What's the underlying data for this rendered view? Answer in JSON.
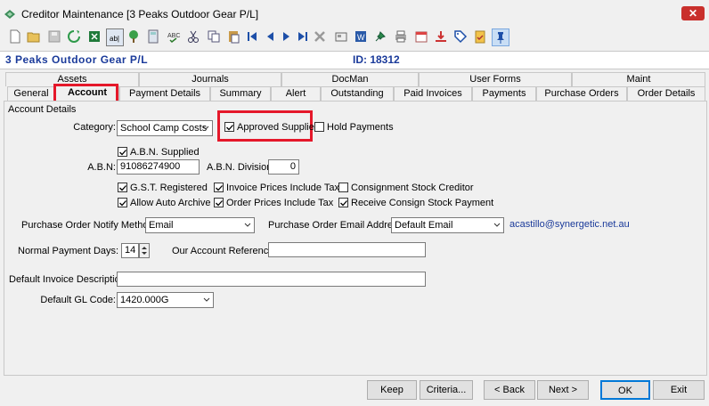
{
  "window": {
    "title": "Creditor Maintenance  [3 Peaks Outdoor Gear P/L]",
    "close_label": "✕"
  },
  "toolbar": {
    "icons": [
      "new-icon",
      "open-icon",
      "save-icon",
      "refresh-icon",
      "excel-icon",
      "text-field-icon",
      "tree-icon",
      "calculator-icon",
      "spell-check-icon",
      "cut-icon",
      "copy-icon",
      "paste-icon",
      "first-icon",
      "prev-icon",
      "next-icon",
      "last-icon",
      "delete-icon",
      "card-icon",
      "word-icon",
      "pin-icon",
      "print-icon",
      "calendar-icon",
      "download-icon",
      "tag-icon",
      "clipboard-icon",
      "pin-active-icon"
    ]
  },
  "info": {
    "creditor_name": "3 Peaks Outdoor Gear P/L",
    "id_text": "ID: 18312"
  },
  "tabs": {
    "row1": [
      "Assets",
      "Journals",
      "DocMan",
      "User Forms",
      "Maint"
    ],
    "row2": [
      "General",
      "Account",
      "Payment Details",
      "Summary",
      "Alert",
      "Outstanding",
      "Paid Invoices",
      "Payments",
      "Purchase Orders",
      "Order Details"
    ],
    "active": "Account"
  },
  "form": {
    "group_title": "Account Details",
    "category_label": "Category:",
    "category_value": "School Camp Costs",
    "approved_supplier_label": "Approved Supplier",
    "approved_supplier_checked": true,
    "hold_payments_label": "Hold Payments",
    "hold_payments_checked": false,
    "abn_supplied_label": "A.B.N. Supplied",
    "abn_supplied_checked": true,
    "abn_label": "A.B.N:",
    "abn_value": "91086274900",
    "abn_division_label": "A.B.N. Division:",
    "abn_division_value": "0",
    "gst_registered_label": "G.S.T. Registered",
    "gst_registered_checked": true,
    "invoice_prices_label": "Invoice Prices Include Tax",
    "invoice_prices_checked": true,
    "consignment_label": "Consignment Stock Creditor",
    "consignment_checked": false,
    "auto_archive_label": "Allow Auto Archive",
    "auto_archive_checked": true,
    "order_prices_label": "Order Prices Include Tax",
    "order_prices_checked": true,
    "receive_consign_label": "Receive Consign Stock Payment",
    "receive_consign_checked": true,
    "po_notify_label": "Purchase Order Notify Method:",
    "po_notify_value": "Email",
    "po_email_label": "Purchase Order Email Address:",
    "po_email_value": "Default Email",
    "po_email_link": "acastillo@synergetic.net.au",
    "payment_days_label": "Normal Payment Days:",
    "payment_days_value": "14",
    "account_ref_label": "Our Account Reference:",
    "account_ref_value": "",
    "invoice_desc_label": "Default Invoice Description:",
    "invoice_desc_value": "",
    "gl_code_label": "Default GL Code:",
    "gl_code_value": "1420.000G"
  },
  "buttons": {
    "keep": "Keep",
    "criteria": "Criteria...",
    "back": "< Back",
    "next": "Next >",
    "ok": "OK",
    "exit": "Exit"
  },
  "colors": {
    "highlight": "#e5182a",
    "info_text": "#1a3a9a",
    "ok_border": "#0078d7"
  }
}
